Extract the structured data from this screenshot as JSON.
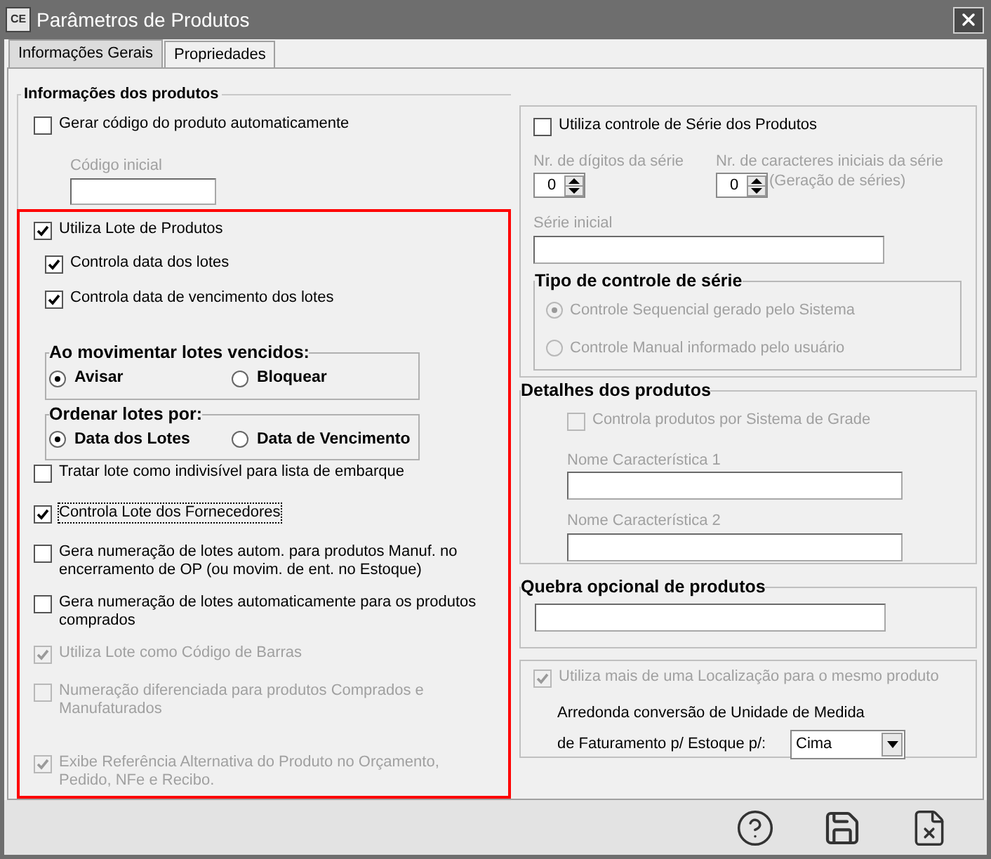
{
  "window": {
    "app_badge": "CE",
    "title": "Parâmetros de Produtos"
  },
  "tabs": [
    {
      "label": "Informações Gerais",
      "selected": true
    },
    {
      "label": "Propriedades",
      "selected": false
    }
  ],
  "product_info": {
    "title": "Informações dos produtos",
    "generate_code": {
      "label": "Gerar código do produto automaticamente",
      "checked": false,
      "disabled": false
    },
    "initial_code": {
      "label": "Código inicial",
      "disabled": true
    }
  },
  "lot_settings": [
    {
      "kind": "checkbox",
      "label": "Utiliza Lote de Produtos",
      "checked": true,
      "disabled": false,
      "focused": false,
      "children": [
        {
          "label": "Controla data dos lotes",
          "checked": true,
          "disabled": false,
          "focused": false
        },
        {
          "label": "Controla data de vencimento dos lotes",
          "checked": true,
          "disabled": false,
          "focused": false
        }
      ]
    },
    {
      "kind": "radio_group",
      "title": "Ao movimentar lotes vencidos:",
      "options": [
        {
          "label": "Avisar",
          "selected": true
        },
        {
          "label": "Bloquear",
          "selected": false
        }
      ]
    },
    {
      "kind": "radio_group",
      "title": "Ordenar lotes por:",
      "options": [
        {
          "label": "Data dos Lotes",
          "selected": true
        },
        {
          "label": "Data de Vencimento",
          "selected": false
        }
      ]
    },
    {
      "kind": "checkbox",
      "label": "Tratar lote como indivisível para lista de embarque",
      "checked": false,
      "disabled": false,
      "focused": false
    },
    {
      "kind": "checkbox",
      "label": "Controla Lote dos Fornecedores",
      "checked": true,
      "disabled": false,
      "focused": true
    },
    {
      "kind": "checkbox",
      "label": "Gera numeração de lotes autom. para produtos Manuf. no encerramento de OP (ou movim. de ent. no Estoque)",
      "checked": false,
      "disabled": false,
      "focused": false
    },
    {
      "kind": "checkbox",
      "label": "Gera numeração de lotes automaticamente para os produtos comprados",
      "checked": false,
      "disabled": false,
      "focused": false
    },
    {
      "kind": "checkbox",
      "label": "Utiliza Lote como Código de Barras",
      "checked": true,
      "disabled": true,
      "focused": false
    },
    {
      "kind": "checkbox",
      "label": "Numeração diferenciada para produtos Comprados e Manufaturados",
      "checked": false,
      "disabled": true,
      "focused": false
    },
    {
      "kind": "checkbox",
      "label": "Exibe Referência Alternativa do Produto no Orçamento, Pedido, NFe e Recibo.",
      "checked": true,
      "disabled": true,
      "focused": false
    }
  ],
  "serial": {
    "use_serial": {
      "label": "Utiliza controle de Série dos Produtos",
      "checked": false,
      "disabled": false
    },
    "digits": {
      "label": "Nr. de dígitos da série",
      "value": "0",
      "disabled": true
    },
    "prefix_chars": {
      "label": "Nr. de caracteres iniciais da série",
      "note": "(Geração de séries)",
      "value": "0",
      "disabled": true
    },
    "initial_serial": {
      "label": "Série inicial",
      "disabled": true
    },
    "control_type": {
      "title": "Tipo de controle de série",
      "disabled": true,
      "options": [
        {
          "label": "Controle Sequencial gerado pelo Sistema",
          "selected": true
        },
        {
          "label": "Controle Manual informado pelo usuário",
          "selected": false
        }
      ]
    }
  },
  "product_details": {
    "title": "Detalhes dos produtos",
    "grid": {
      "label": "Controla produtos por Sistema de Grade",
      "checked": false,
      "disabled": true
    },
    "fields": [
      {
        "label": "Nome Característica 1",
        "disabled": true
      },
      {
        "label": "Nome Característica 2",
        "disabled": true
      }
    ]
  },
  "optional_break": {
    "title": "Quebra opcional de produtos"
  },
  "location": {
    "multi_location": {
      "label": "Utiliza mais de uma Localização para o mesmo produto",
      "checked": true,
      "disabled": true
    },
    "rounding_line1": "Arredonda conversão de Unidade de Medida",
    "rounding_line2": "de Faturamento p/ Estoque p/:",
    "rounding_value": "Cima"
  }
}
